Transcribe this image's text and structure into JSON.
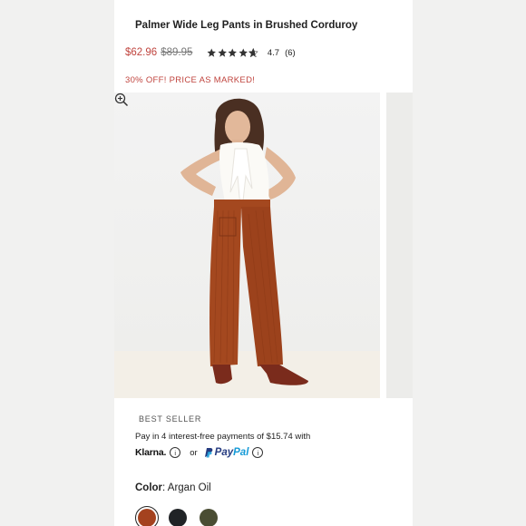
{
  "product": {
    "title": "Palmer Wide Leg Pants in Brushed Corduroy",
    "sale_price": "$62.96",
    "original_price": "$89.95",
    "rating": "4.7",
    "review_count": "(6)",
    "stars_filled": 4.7,
    "promo": "30% OFF! PRICE AS MARKED!",
    "badge": "BEST SELLER"
  },
  "payment": {
    "installment_text": "Pay in 4 interest-free payments of $15.74 with",
    "klarna_label": "Klarna.",
    "or_text": "or",
    "paypal_pay": "Pay",
    "paypal_pal": "Pal",
    "info_glyph": "i"
  },
  "color": {
    "label": "Color",
    "value": ": Argan Oil",
    "swatches": [
      {
        "name": "Argan Oil",
        "hex": "#a4421f",
        "selected": true
      },
      {
        "name": "Black",
        "hex": "#202326",
        "selected": false
      },
      {
        "name": "Olive",
        "hex": "#4a4d33",
        "selected": false
      }
    ]
  },
  "icons": {
    "zoom": "zoom-in-icon",
    "star": "star-icon",
    "info": "info-icon",
    "paypal": "paypal-logo-icon"
  },
  "colors": {
    "sale": "#c0453f",
    "pants": "#a4481f",
    "accent_star": "#333333"
  }
}
